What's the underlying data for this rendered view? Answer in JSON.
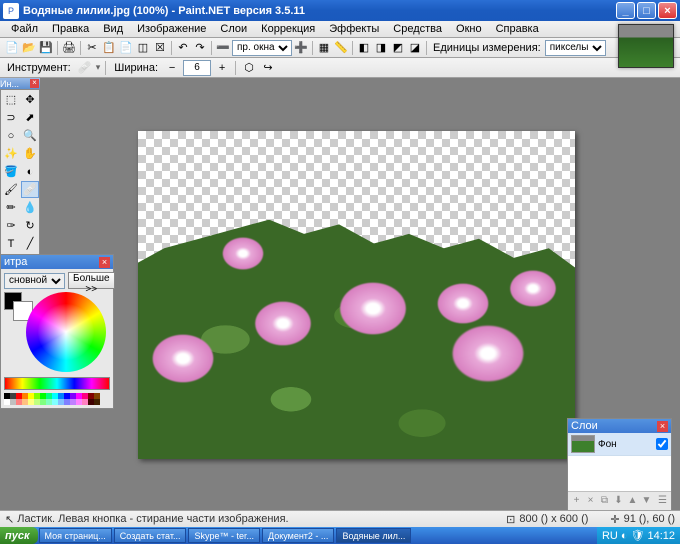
{
  "titlebar": {
    "title": "Водяные лилии.jpg (100%) - Paint.NET версия 3.5.11"
  },
  "menu": [
    "Файл",
    "Правка",
    "Вид",
    "Изображение",
    "Слои",
    "Коррекция",
    "Эффекты",
    "Средства",
    "Окно",
    "Справка"
  ],
  "toolbar1": {
    "units_label": "Единицы измерения:",
    "units_value": "пикселы"
  },
  "toolbar2": {
    "instrument": "Инструмент:",
    "width": "Ширина:",
    "width_value": "6"
  },
  "tools_title": "Ин...",
  "color": {
    "title": "итра",
    "primary_opt": "сновной",
    "more": "Больше >>"
  },
  "layers": {
    "title": "Слои",
    "layer0": "Фон"
  },
  "status": {
    "hint": "Ластик. Левая кнопка - стирание части изображения.",
    "dims": "800 () x 600 ()",
    "pos": "91 (), 60 ()"
  },
  "taskbar": {
    "start": "пуск",
    "items": [
      "Моя страниц...",
      "Создать стат...",
      "Skype™ - ter...",
      "Документ2 - ...",
      "Водяные лил..."
    ],
    "lang": "RU",
    "time": "14:12"
  },
  "palette_colors": [
    "#000",
    "#404040",
    "#f00",
    "#ff8000",
    "#ff0",
    "#80ff00",
    "#0f0",
    "#00ff80",
    "#0ff",
    "#0080ff",
    "#00f",
    "#8000ff",
    "#f0f",
    "#ff0080",
    "#800000",
    "#804000",
    "#fff",
    "#c0c0c0",
    "#ff8080",
    "#ffc080",
    "#ffff80",
    "#c0ff80",
    "#80ff80",
    "#80ffc0",
    "#80ffff",
    "#80c0ff",
    "#8080ff",
    "#c080ff",
    "#ff80ff",
    "#ff80c0",
    "#400000",
    "#402000"
  ]
}
